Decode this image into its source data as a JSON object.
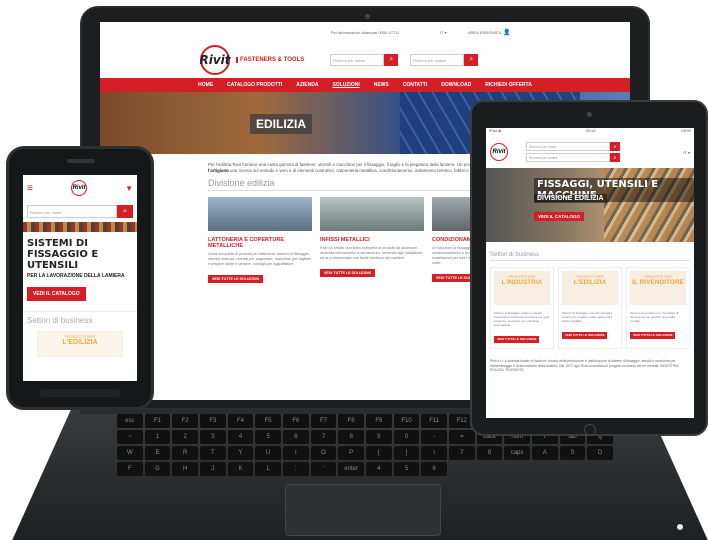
{
  "laptop": {
    "topbar_text": "Per informazioni chiamare 0000 47711",
    "lang": "IT ▾",
    "area": "AREA RISERVATA",
    "logo_text": "Rivit",
    "logo_tag": "FASTENERS & TOOLS",
    "search1_placeholder": "Ricerca per nome",
    "search2_placeholder": "Ricerca per codice",
    "nav": [
      "HOME",
      "CATALOGO PRODOTTI",
      "AZIENDA",
      "SOLUZIONI",
      "NEWS",
      "CONTATTI",
      "DOWNLOAD",
      "RICHIEDI OFFERTA"
    ],
    "hero_title": "EDILIZIA",
    "intro_text": "Per l'edilizia Rivit fornisce una vasta gamma di fastener, utensili e macchine per il fissaggio, il taglio e la piegatura della lamiera. Un programma adatto a ",
    "intro_bold": "garantire per l'imprenditore e l'artigiano",
    "intro_text2": " una ricerca sul metodo e vero e di elementi costruttivi, carpenteria metallica, condizionamento, isolamento termico, fabbri e lattonieri.",
    "section_title": "Divisione edilizia",
    "cards": [
      {
        "title": "LATTONERIA E COPERTURE METALLICHE",
        "text": "Linea completa di prodotti per lattoneria: sistemi di fissaggio, utensili manuali, utensili per sagomare, macchine per tagliare e piegare lastre e lamiere, consigli per aggraffature.",
        "cta": "VEDI TUTTE LE SOLUZIONI"
      },
      {
        "title": "INFISSI METALLICI",
        "text": "Rivit ha creato una linea completa di prodotti da accessori dedicata interamente al serramento, fornendo agli installatori ed ai professionisti una facile fornitura del cantiere.",
        "cta": "VEDI TUTTE LE SOLUZIONI"
      },
      {
        "title": "CONDIZIONAMENTO",
        "text": "Le soluzioni di fissaggio e gli utensili adatti per il condizionamento e la ventilazione, sistemi per isolamenti e installazioni per tutti i tipi di impianti in ambito industriale e civile.",
        "cta": "VEDI TUTTE LE SOLUZIONI"
      }
    ],
    "keys": [
      "esc",
      "F1",
      "F2",
      "F3",
      "F4",
      "F5",
      "F6",
      "F7",
      "F8",
      "F9",
      "F10",
      "F11",
      "F12",
      "prt",
      "ins",
      "del",
      "home",
      "end",
      "~",
      "1",
      "2",
      "3",
      "4",
      "5",
      "6",
      "7",
      "8",
      "9",
      "0",
      "-",
      "=",
      "back",
      "num",
      "/",
      "tab",
      "Q",
      "W",
      "E",
      "R",
      "T",
      "Y",
      "U",
      "I",
      "O",
      "P",
      "[",
      "]",
      "\\",
      "7",
      "8",
      "caps",
      "A",
      "S",
      "D",
      "F",
      "G",
      "H",
      "J",
      "K",
      "L",
      ";",
      "'",
      "enter",
      "4",
      "5",
      "6"
    ]
  },
  "phone": {
    "menu_icon": "≡",
    "logo_text": "Rivit",
    "arrow_icon": "▼",
    "search_placeholder": "Ricerca per nome",
    "title": "SISTEMI DI FISSAGGIO E UTENSILI",
    "subtitle": "PER LA LAVORAZIONE DELLA LAMIERA",
    "cta": "VEDI IL CATALOGO",
    "section_title": "Settori di business",
    "card_l1": "PRODOTTI PER",
    "card_l2": "L'EDILIZIA"
  },
  "tablet": {
    "status_left": "iPad ◈",
    "status_time": "09:41",
    "status_right": "100%",
    "logo_text": "Rivit",
    "search1_placeholder": "Ricerca per nome",
    "search2_placeholder": "Ricerca per codice",
    "lang": "IT ▾",
    "hero_title": "FISSAGGI, UTENSILI E MACCHINE",
    "hero_sub": "DIVISIONE EDILIZIA",
    "hero_cta": "VEDI IL CATALOGO",
    "section_title": "Settori di business",
    "cards": [
      {
        "l1": "PRODOTTI PER",
        "l2": "L'INDUSTRIA",
        "text": "Sistemi di fissaggio rapido e utensili industriali per lavorare la lamiera per ogni esigenza, accessori per macchine automatiche.",
        "cta": "VEDI TUTTE LE SOLUZIONI"
      },
      {
        "l1": "PRODOTTI PER",
        "l2": "L'EDILIZIA",
        "text": "Sistemi di fissaggio, utensili manuali e elettrici per il settore edile, lattoneria e infissi metallici.",
        "cta": "VEDI TUTTE LE SOLUZIONI"
      },
      {
        "l1": "PRODOTTI PER",
        "l2": "IL RIVENDITORE",
        "text": "Gamma di prodotti per i rivenditori di ferramenta con prodotti pronti alla vendita.",
        "cta": "VEDI TUTTE LE SOLUZIONI"
      }
    ],
    "foot_text": "Rivit s.r.l. è azienda leader in Italia nel mondo della produzione e distribuzione di sistemi di fissaggio utensili e macchine per l'assemblaggio e la lavorazione della lamiera. Dal 1972 ogni Rivit concretizza il progetto business nei tre mercati: INDUSTRIA, EDILIZIA, RIVENDITA."
  }
}
